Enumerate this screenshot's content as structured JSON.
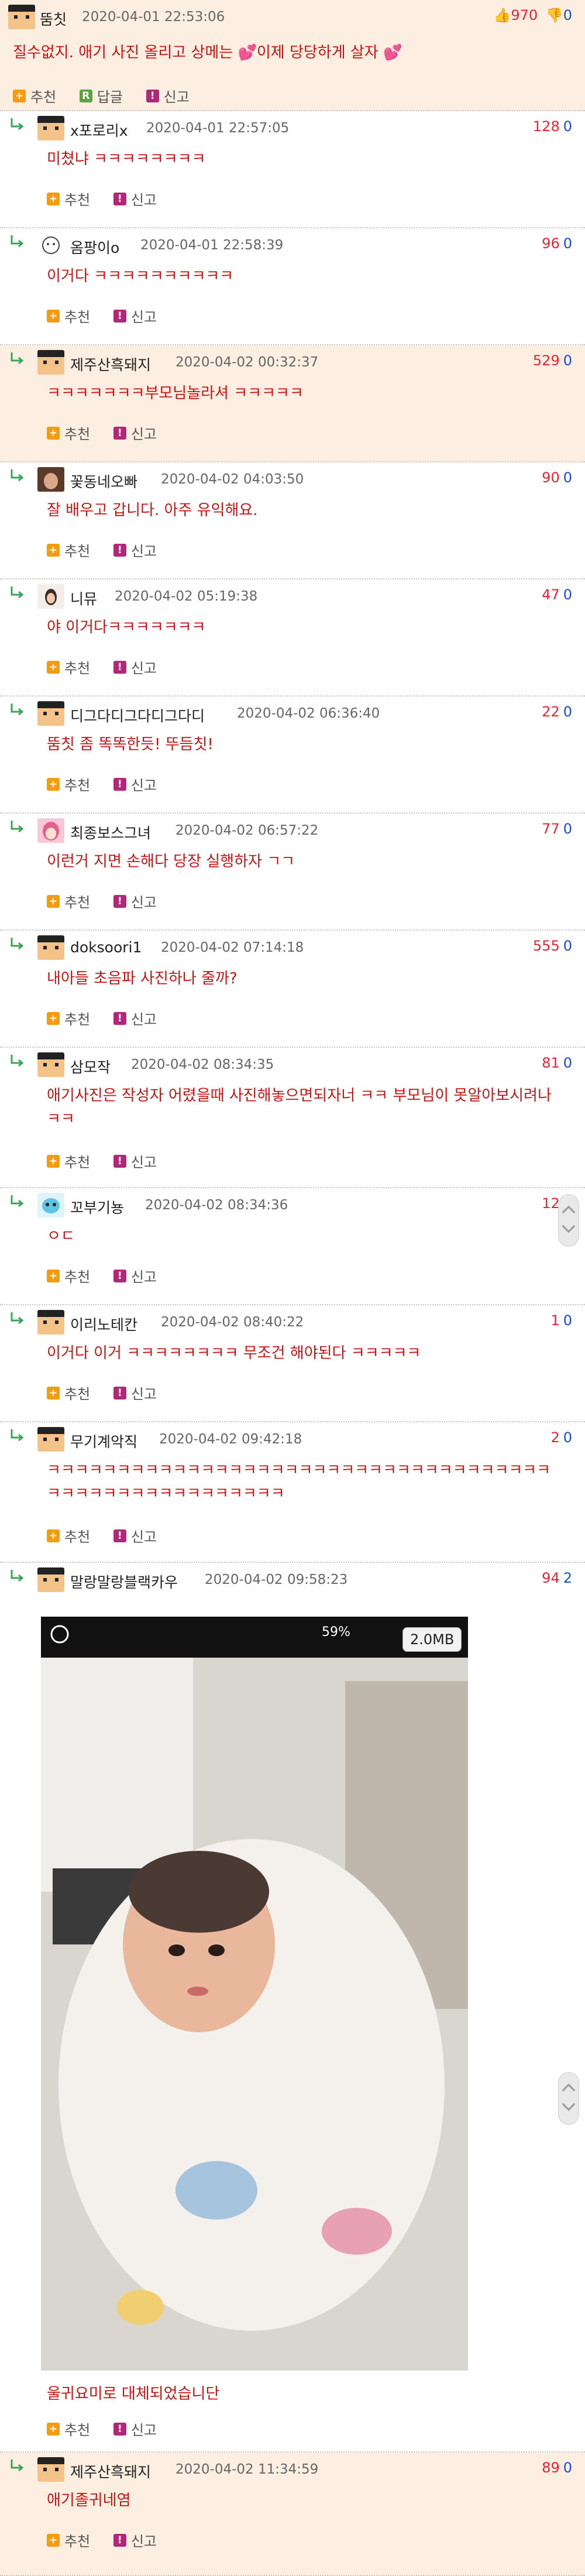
{
  "comments": [
    {
      "nick": "뚬칫",
      "date": "2020-04-01 22:53:06",
      "up": "970",
      "down": "0",
      "text": "질수없지. 애기 사진 올리고 상메는 💕이제 당당하게 살자 💕",
      "recommend": "추천",
      "reply": "답글",
      "report": "신고"
    },
    {
      "nick": "x포로리x",
      "date": "2020-04-01 22:57:05",
      "up": "128",
      "down": "0",
      "text": "미쳤냐 ㅋㅋㅋㅋㅋㅋㅋㅋ",
      "recommend": "추천",
      "report": "신고"
    },
    {
      "nick": "옴팡이o",
      "date": "2020-04-01 22:58:39",
      "up": "96",
      "down": "0",
      "text": "이거다 ㅋㅋㅋㅋㅋㅋㅋㅋㅋㅋ",
      "recommend": "추천",
      "report": "신고"
    },
    {
      "nick": "제주산흑돼지",
      "date": "2020-04-02 00:32:37",
      "up": "529",
      "down": "0",
      "text": "ㅋㅋㅋㅋㅋㅋㅋ부모님놀라셔 ㅋㅋㅋㅋㅋ",
      "recommend": "추천",
      "report": "신고"
    },
    {
      "nick": "꽃동네오빠",
      "date": "2020-04-02 04:03:50",
      "up": "90",
      "down": "0",
      "text": "잘 배우고 갑니다. 아주 유익해요.",
      "recommend": "추천",
      "report": "신고"
    },
    {
      "nick": "니뮤",
      "date": "2020-04-02 05:19:38",
      "up": "47",
      "down": "0",
      "text": "야 이거다ㅋㅋㅋㅋㅋㅋㅋ",
      "recommend": "추천",
      "report": "신고"
    },
    {
      "nick": "디그다디그다디그다디",
      "date": "2020-04-02 06:36:40",
      "up": "22",
      "down": "0",
      "text": "뚬칫 좀 똑똑한듯! 뚜듬칫!",
      "recommend": "추천",
      "report": "신고"
    },
    {
      "nick": "최종보스그녀",
      "date": "2020-04-02 06:57:22",
      "up": "77",
      "down": "0",
      "text": "이런거 지면 손해다 당장 실행하자 ㄱㄱ",
      "recommend": "추천",
      "report": "신고"
    },
    {
      "nick": "doksoori1",
      "date": "2020-04-02 07:14:18",
      "up": "555",
      "down": "0",
      "text": "내아들 초음파 사진하나 줄까?",
      "recommend": "추천",
      "report": "신고"
    },
    {
      "nick": "삼모작",
      "date": "2020-04-02 08:34:35",
      "up": "81",
      "down": "0",
      "text": "애기사진은 작성자 어렸을때 사진해놓으면되자너 ㅋㅋ 부모님이 못알아보시려나 ㅋㅋ",
      "recommend": "추천",
      "report": "신고"
    },
    {
      "nick": "꼬부기뇽",
      "date": "2020-04-02 08:34:36",
      "up": "12",
      "down": "0",
      "text": "ㅇㄷ",
      "recommend": "추천",
      "report": "신고"
    },
    {
      "nick": "이리노테칸",
      "date": "2020-04-02 08:40:22",
      "up": "1",
      "down": "0",
      "text": "이거다 이거 ㅋㅋㅋㅋㅋㅋㅋㅋ 무조건 해야된다 ㅋㅋㅋㅋㅋ",
      "recommend": "추천",
      "report": "신고"
    },
    {
      "nick": "무기계악직",
      "date": "2020-04-02 09:42:18",
      "up": "2",
      "down": "0",
      "text": "ㅋㅋㅋㅋㅋㅋㅋㅋㅋㅋㅋㅋㅋㅋㅋㅋㅋㅋㅋㅋㅋㅋㅋㅋㅋㅋㅋㅋㅋㅋㅋㅋㅋㅋㅋㅋㅋㅋㅋㅋㅋㅋㅋㅋㅋㅋㅋㅋㅋㅋㅋㅋㅋ",
      "recommend": "추천",
      "report": "신고"
    },
    {
      "nick": "말랑말랑블랙카우",
      "date": "2020-04-02 09:58:23",
      "up": "94",
      "down": "2",
      "text": "울귀요미로 대체되었습니단",
      "recommend": "추천",
      "report": "신고",
      "photo_size": "2.0MB",
      "photo_status": "59%"
    },
    {
      "nick": "제주산흑돼지",
      "date": "2020-04-02 11:34:59",
      "up": "89",
      "down": "0",
      "text": "애기졸귀네염",
      "recommend": "추천",
      "report": "신고"
    }
  ],
  "colors": {
    "accent": "#c81414",
    "upvote": "#e23333",
    "downvote": "#1a4dd6",
    "highlight": "#fdeee2"
  }
}
